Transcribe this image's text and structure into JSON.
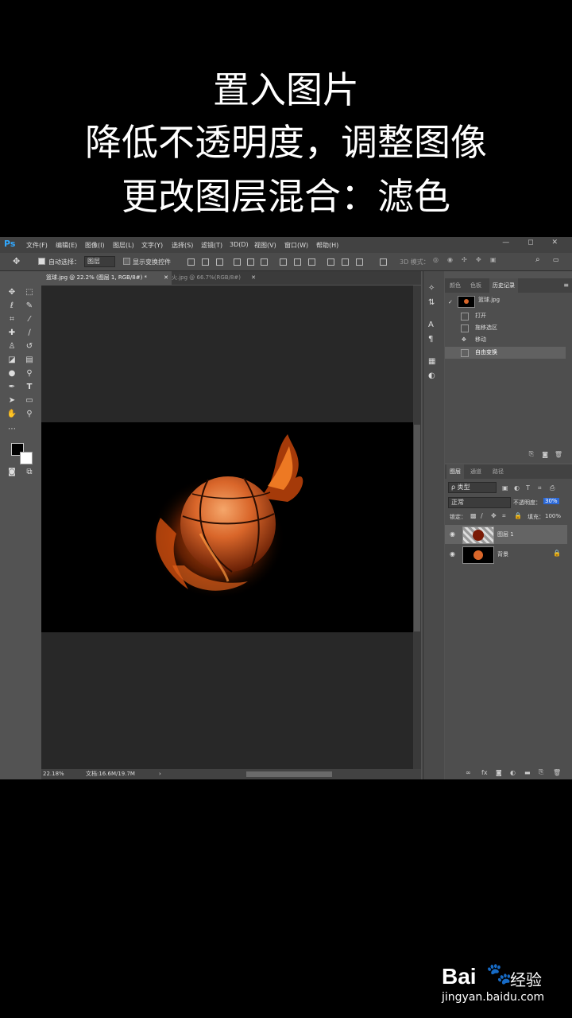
{
  "caption": {
    "line1": "置入图片",
    "line2": "降低不透明度，调整图像",
    "line3": "更改图层混合：滤色"
  },
  "app": {
    "logo": "Ps",
    "menus": [
      "文件(F)",
      "编辑(E)",
      "图像(I)",
      "图层(L)",
      "文字(Y)",
      "选择(S)",
      "滤镜(T)",
      "3D(D)",
      "视图(V)",
      "窗口(W)",
      "帮助(H)"
    ],
    "window_buttons": "— ◻ ✕"
  },
  "options": {
    "auto_select_label": "自动选择：",
    "auto_select_value": "图层",
    "show_transform_label": "显示变换控件",
    "mode_3d_label": "3D 模式："
  },
  "tabs": {
    "active": "篮球.jpg @ 22.2% (图层 1, RGB/8#) *",
    "inactive": "火.jpg @ 66.7%(RGB/8#)"
  },
  "status": {
    "zoom": "22.18%",
    "doc": "文档:16.6M/19.7M"
  },
  "history": {
    "tabs": [
      "颜色",
      "色板",
      "历史记录"
    ],
    "snapshot": "篮球.jpg",
    "items": [
      "打开",
      "拖移选区",
      "移动",
      "自由变换"
    ]
  },
  "layers": {
    "tabs": [
      "图层",
      "通道",
      "路径"
    ],
    "filter": "ρ 类型",
    "blend_mode": "正常",
    "opacity_label": "不透明度：",
    "opacity_value": "30%",
    "lock_label": "锁定：",
    "fill_label": "填充：",
    "fill_value": "100%",
    "items": [
      {
        "name": "图层 1"
      },
      {
        "name": "背景"
      }
    ]
  },
  "watermark": {
    "brand": "Bai",
    "brand2": "经验",
    "url": "jingyan.baidu.com"
  },
  "colors": {
    "accent": "#31a8ff",
    "panel": "#535353",
    "menubar": "#424242"
  }
}
